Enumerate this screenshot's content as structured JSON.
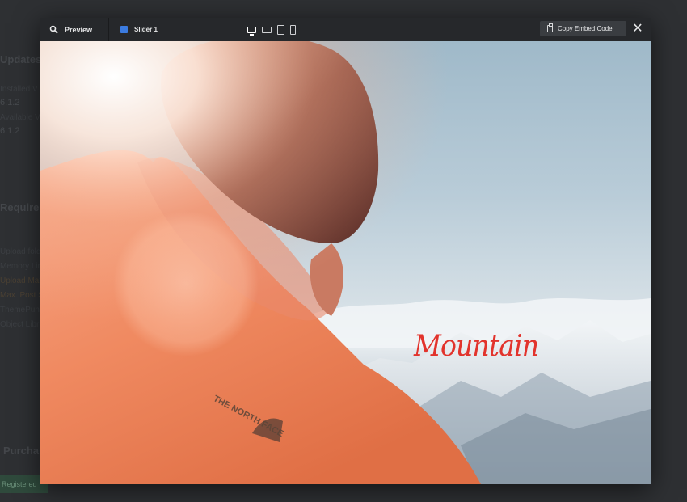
{
  "background": {
    "updates_heading": "Updates",
    "installed_label": "Installed V",
    "installed_value": "6.1.2",
    "available_label": "Available V",
    "available_value": "6.1.2",
    "requirements_heading": "Requirem",
    "requirements": [
      "Upload fold",
      "Memory Lim",
      "Upload Max",
      "Max. Post S",
      "ThemePunch",
      "Object Libr"
    ],
    "purchase_heading": "Purchase",
    "registered_label": "Registered"
  },
  "modal": {
    "preview_label": "Preview",
    "slider_label": "Slider 1",
    "devices": [
      "desktop",
      "laptop",
      "tablet",
      "phone"
    ],
    "active_device": "desktop",
    "copy_embed_label": "Copy Embed Code",
    "close_label": "✕",
    "accent_color": "#3b7be0"
  },
  "slide": {
    "caption": "Mountain",
    "caption_color": "#e2332c",
    "logo_text": "THE NORTH FACE"
  }
}
